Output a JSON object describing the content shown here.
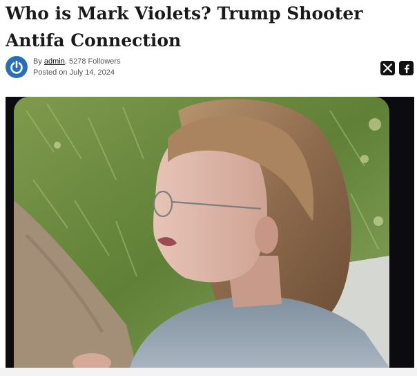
{
  "article": {
    "title": "Who is Mark Violets? Trump Shooter Antifa Connection",
    "by_prefix": "By",
    "author": "admin",
    "followers": ", 5278 Followers",
    "posted": "Posted on July 14, 2024"
  },
  "icons": {
    "avatar": "power-logo-icon",
    "share_x": "x-icon",
    "share_facebook": "facebook-icon"
  },
  "colors": {
    "avatar_blue": "#2a6fb5",
    "social_bg": "#111111"
  }
}
